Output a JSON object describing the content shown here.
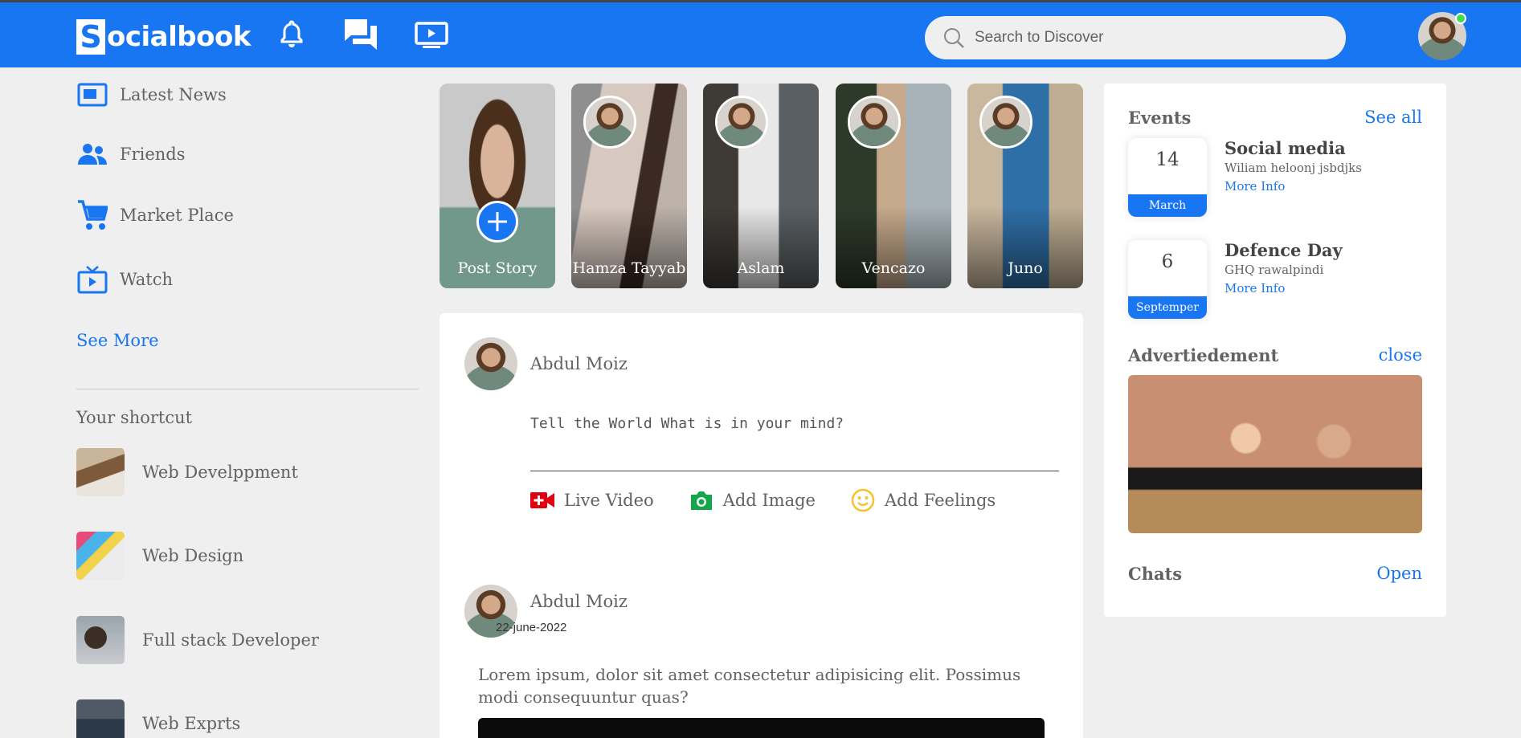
{
  "header": {
    "logo_letter": "S",
    "logo_rest": "ocialbook",
    "search_placeholder": "Search to Discover",
    "colors": {
      "primary": "#1876f2",
      "background": "#efefef",
      "online": "#41db51"
    }
  },
  "sidebar": {
    "items": [
      {
        "label": "Latest News",
        "icon": "news-icon"
      },
      {
        "label": "Friends",
        "icon": "friends-icon"
      },
      {
        "label": "Market Place",
        "icon": "cart-icon"
      },
      {
        "label": "Watch",
        "icon": "tv-icon"
      }
    ],
    "see_more": "See More",
    "shortcut_title": "Your shortcut",
    "shortcuts": [
      {
        "label": "Web Develppment"
      },
      {
        "label": "Web Design"
      },
      {
        "label": "Full stack Developer"
      },
      {
        "label": "Web Exprts"
      }
    ]
  },
  "stories": [
    {
      "label": "Post Story"
    },
    {
      "label": "Hamza Tayyab"
    },
    {
      "label": "Aslam"
    },
    {
      "label": "Vencazo"
    },
    {
      "label": "Juno"
    }
  ],
  "composer": {
    "author": "Abdul Moiz",
    "placeholder": "Tell the World What is in your mind?",
    "actions": [
      {
        "label": "Live Video",
        "icon": "live-video-icon"
      },
      {
        "label": "Add Image",
        "icon": "camera-icon"
      },
      {
        "label": "Add Feelings",
        "icon": "smiley-icon"
      }
    ]
  },
  "post": {
    "author": "Abdul Moiz",
    "date": "22-june-2022",
    "text": "Lorem ipsum, dolor sit amet consectetur adipisicing elit. Possimus modi consequuntur quas?"
  },
  "right": {
    "events_title": "Events",
    "see_all": "See all",
    "events": [
      {
        "day": "14",
        "month": "March",
        "title": "Social media",
        "subtitle": "Wiliam heloonj jsbdjks",
        "more": "More Info"
      },
      {
        "day": "6",
        "month": "Septemper",
        "title": "Defence Day",
        "subtitle": "GHQ rawalpindi",
        "more": "More Info"
      }
    ],
    "ad_title": "Advertiedement",
    "ad_close": "close",
    "chats_title": "Chats",
    "chats_open": "Open"
  }
}
